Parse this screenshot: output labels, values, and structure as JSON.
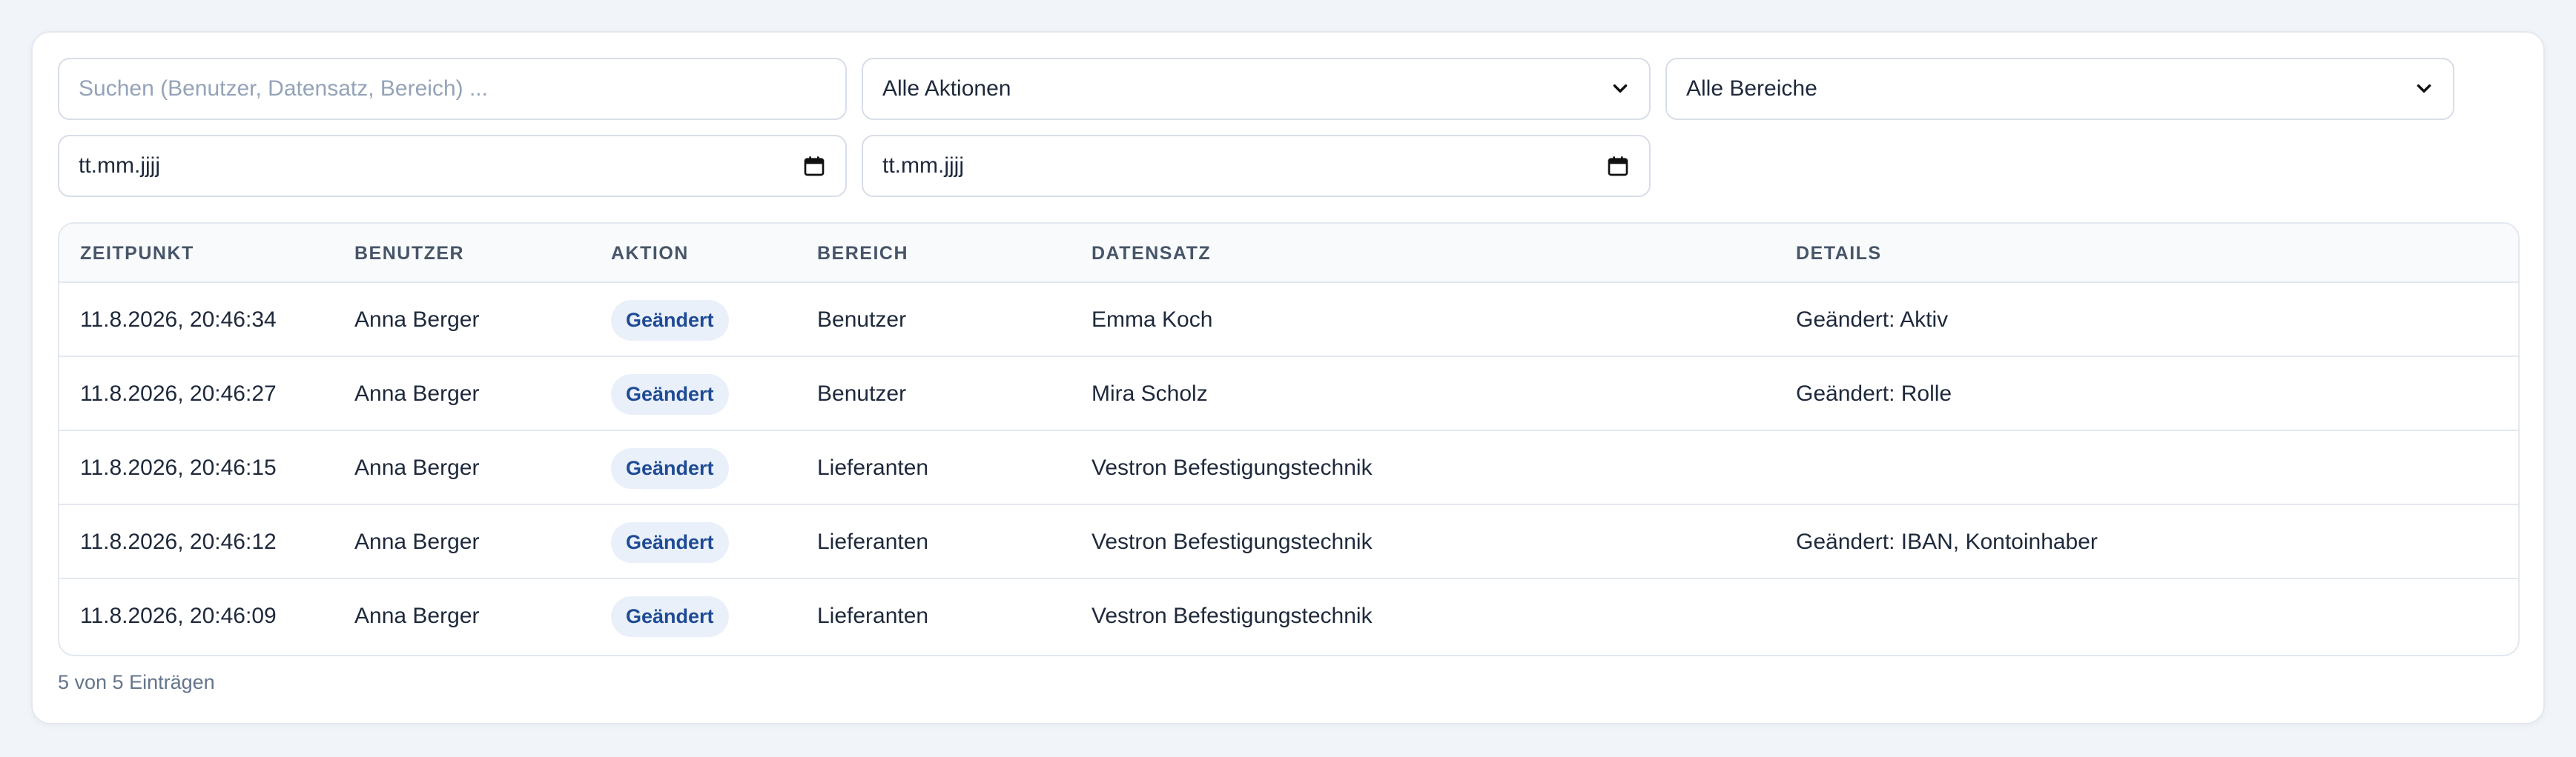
{
  "filters": {
    "search_placeholder": "Suchen (Benutzer, Datensatz, Bereich) ...",
    "action_select": "Alle Aktionen",
    "area_select": "Alle Bereiche",
    "date_from": "tt.mm.jjjj",
    "date_to": "tt.mm.jjjj"
  },
  "table": {
    "headers": [
      "ZEITPUNKT",
      "BENUTZER",
      "AKTION",
      "BEREICH",
      "DATENSATZ",
      "DETAILS"
    ],
    "rows": [
      {
        "time": "11.8.2026, 20:46:34",
        "user": "Anna Berger",
        "action": "Geändert",
        "area": "Benutzer",
        "record": "Emma Koch",
        "details": "Geändert: Aktiv"
      },
      {
        "time": "11.8.2026, 20:46:27",
        "user": "Anna Berger",
        "action": "Geändert",
        "area": "Benutzer",
        "record": "Mira Scholz",
        "details": "Geändert: Rolle"
      },
      {
        "time": "11.8.2026, 20:46:15",
        "user": "Anna Berger",
        "action": "Geändert",
        "area": "Lieferanten",
        "record": "Vestron Befestigungstechnik",
        "details": ""
      },
      {
        "time": "11.8.2026, 20:46:12",
        "user": "Anna Berger",
        "action": "Geändert",
        "area": "Lieferanten",
        "record": "Vestron Befestigungstechnik",
        "details": "Geändert: IBAN, Kontoinhaber"
      },
      {
        "time": "11.8.2026, 20:46:09",
        "user": "Anna Berger",
        "action": "Geändert",
        "area": "Lieferanten",
        "record": "Vestron Befestigungstechnik",
        "details": ""
      }
    ]
  },
  "footer": {
    "count_text": "5 von 5 Einträgen"
  },
  "icons": {
    "select": "chevron-down-icon",
    "date": "calendar-icon"
  },
  "colors": {
    "badge_bg": "#eaf0fa",
    "badge_text": "#1e4b94"
  }
}
